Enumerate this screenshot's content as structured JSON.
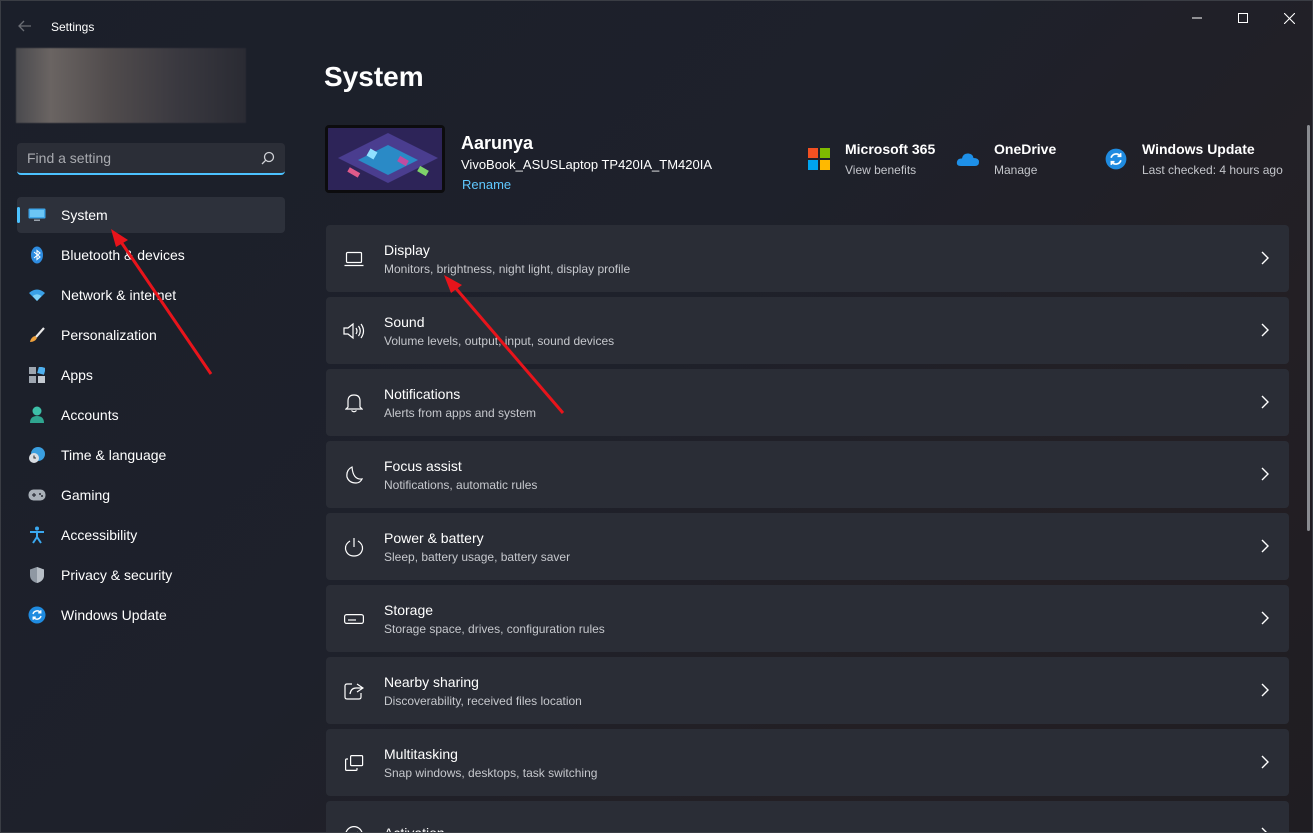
{
  "window": {
    "title": "Settings"
  },
  "search": {
    "placeholder": "Find a setting"
  },
  "sidebar": {
    "items": [
      {
        "label": "System",
        "icon": "monitor-icon",
        "active": true
      },
      {
        "label": "Bluetooth & devices",
        "icon": "bluetooth-icon"
      },
      {
        "label": "Network & internet",
        "icon": "wifi-icon"
      },
      {
        "label": "Personalization",
        "icon": "brush-icon"
      },
      {
        "label": "Apps",
        "icon": "apps-icon"
      },
      {
        "label": "Accounts",
        "icon": "person-icon"
      },
      {
        "label": "Time & language",
        "icon": "clock-globe-icon"
      },
      {
        "label": "Gaming",
        "icon": "gamepad-icon"
      },
      {
        "label": "Accessibility",
        "icon": "accessibility-icon"
      },
      {
        "label": "Privacy & security",
        "icon": "shield-icon"
      },
      {
        "label": "Windows Update",
        "icon": "update-icon"
      }
    ]
  },
  "main": {
    "title": "System",
    "device": {
      "name": "Aarunya",
      "model": "VivoBook_ASUSLaptop TP420IA_TM420IA",
      "rename_label": "Rename"
    },
    "quick_links": [
      {
        "title": "Microsoft 365",
        "subtitle": "View benefits",
        "icon": "microsoft-logo-icon"
      },
      {
        "title": "OneDrive",
        "subtitle": "Manage",
        "icon": "onedrive-cloud-icon"
      },
      {
        "title": "Windows Update",
        "subtitle": "Last checked: 4 hours ago",
        "icon": "update-icon"
      }
    ],
    "settings": [
      {
        "title": "Display",
        "subtitle": "Monitors, brightness, night light, display profile",
        "icon": "laptop-icon"
      },
      {
        "title": "Sound",
        "subtitle": "Volume levels, output, input, sound devices",
        "icon": "speaker-icon"
      },
      {
        "title": "Notifications",
        "subtitle": "Alerts from apps and system",
        "icon": "bell-icon"
      },
      {
        "title": "Focus assist",
        "subtitle": "Notifications, automatic rules",
        "icon": "moon-icon"
      },
      {
        "title": "Power & battery",
        "subtitle": "Sleep, battery usage, battery saver",
        "icon": "power-icon"
      },
      {
        "title": "Storage",
        "subtitle": "Storage space, drives, configuration rules",
        "icon": "storage-icon"
      },
      {
        "title": "Nearby sharing",
        "subtitle": "Discoverability, received files location",
        "icon": "share-icon"
      },
      {
        "title": "Multitasking",
        "subtitle": "Snap windows, desktops, task switching",
        "icon": "multitasking-icon"
      },
      {
        "title": "Activation",
        "subtitle": "",
        "icon": "activation-icon"
      }
    ]
  },
  "colors": {
    "accent": "#4cc2ff",
    "link": "#5fc8ff",
    "annotation": "#e8141b"
  }
}
